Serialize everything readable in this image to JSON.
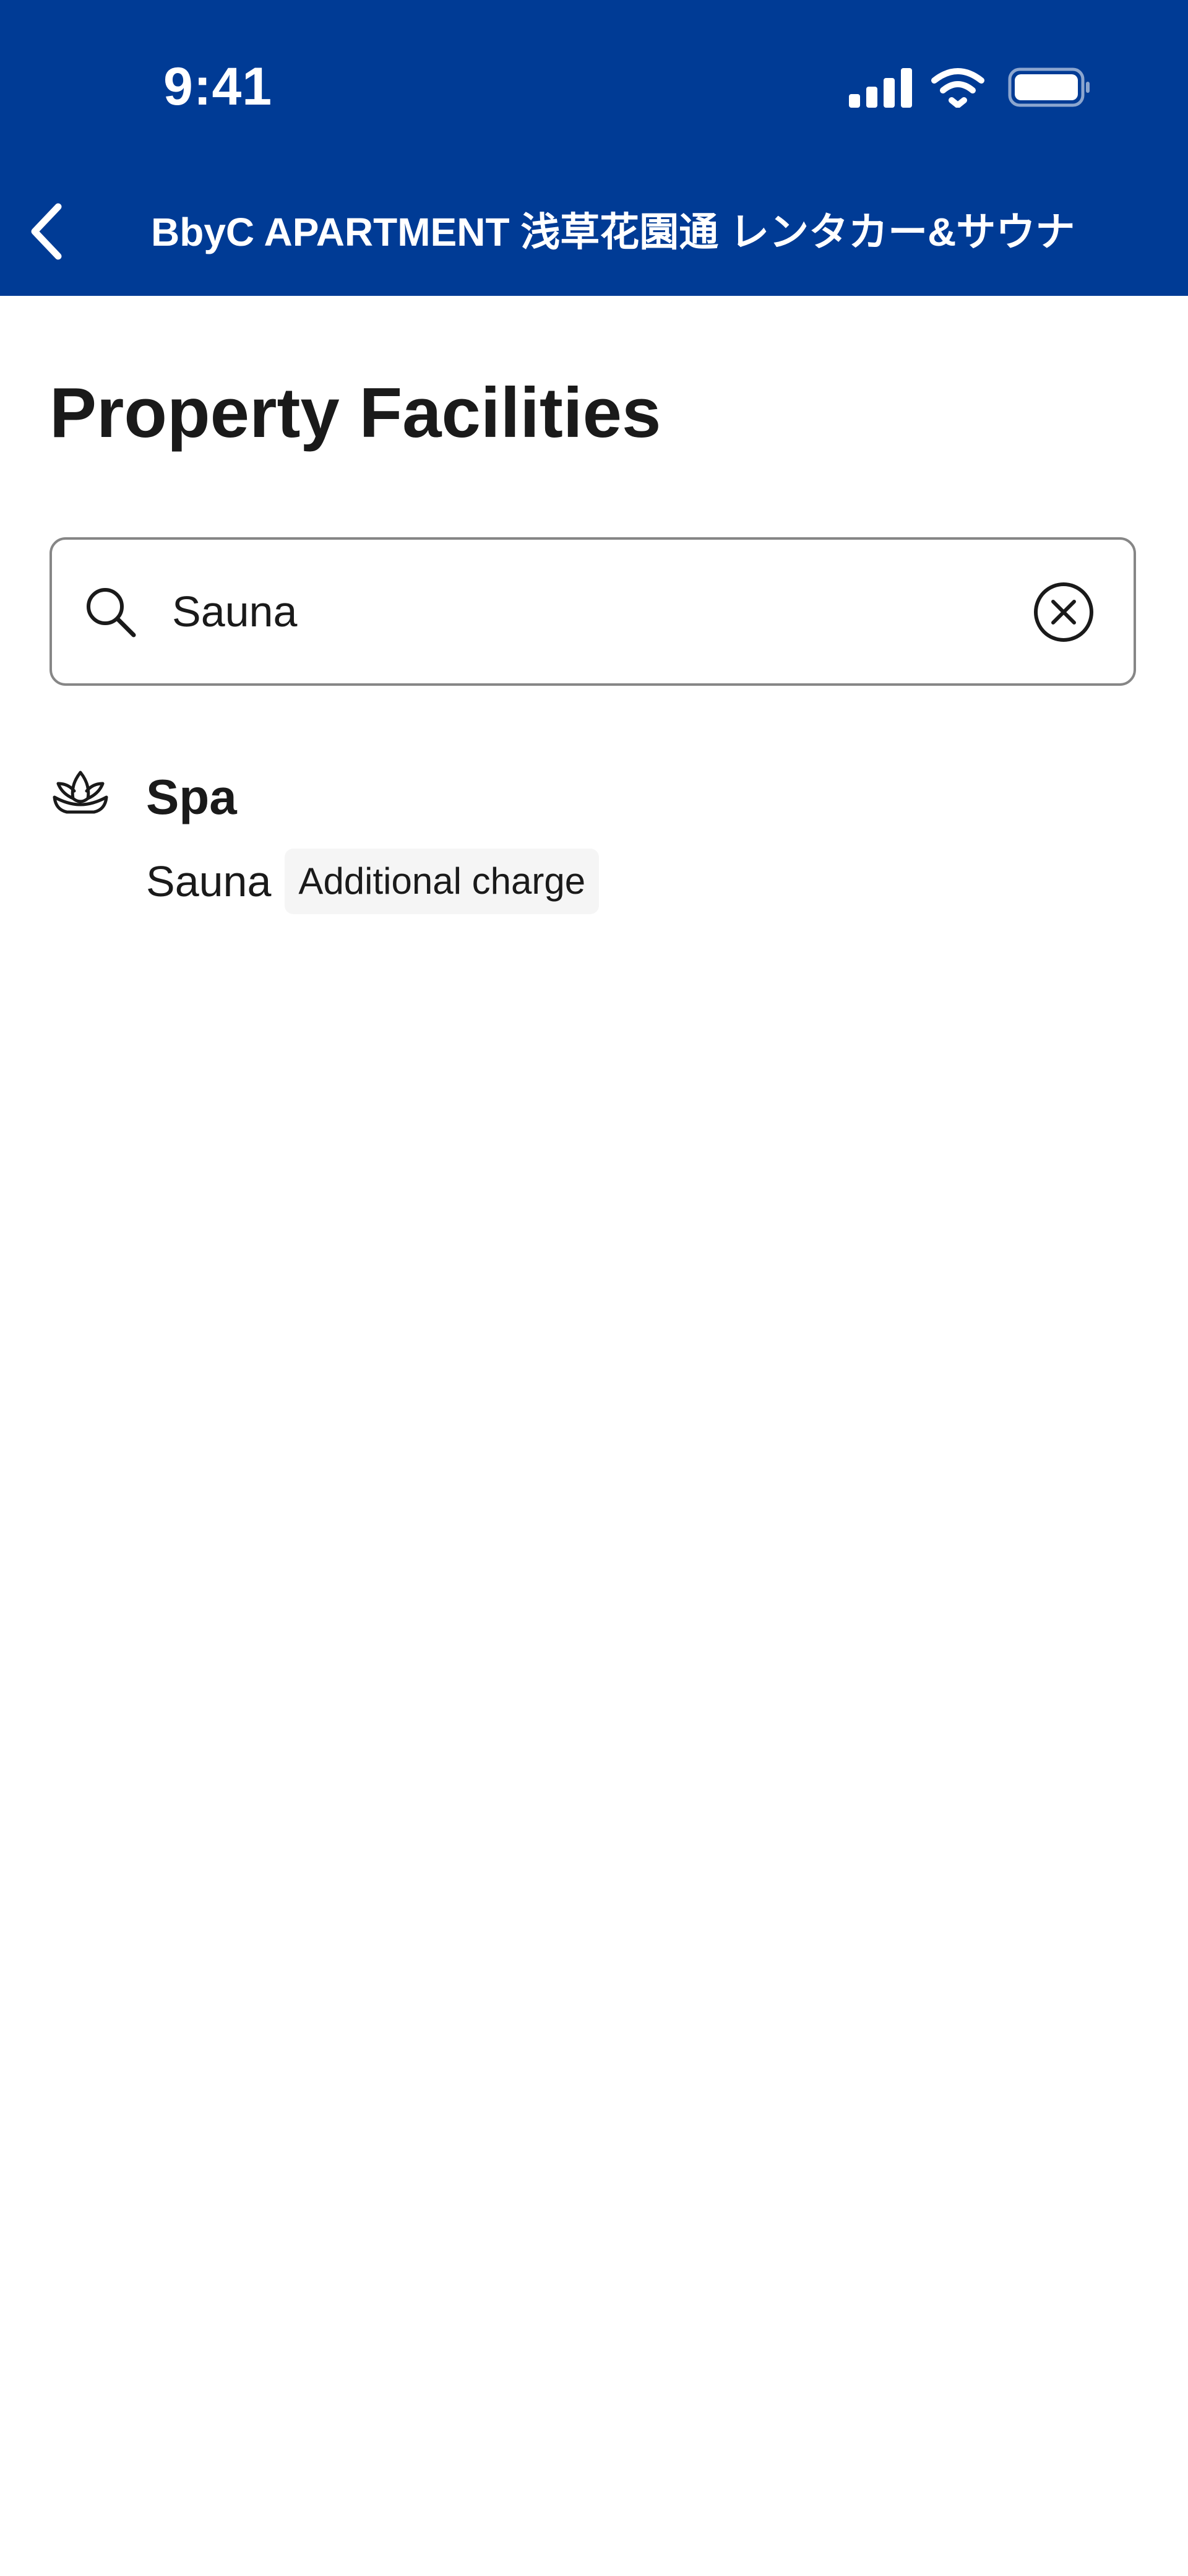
{
  "status_bar": {
    "time": "9:41",
    "icons": [
      "cellular-signal-icon",
      "wifi-icon",
      "battery-icon"
    ]
  },
  "nav": {
    "back_icon": "chevron-left-icon",
    "title": "BbyC APARTMENT 浅草花園通 レンタカー&サウナ"
  },
  "page": {
    "title": "Property Facilities"
  },
  "search": {
    "icon": "search-icon",
    "value": "Sauna",
    "clear_icon": "clear-circle-icon"
  },
  "results": [
    {
      "icon": "spa-lotus-icon",
      "category": "Spa",
      "items": [
        {
          "name": "Sauna",
          "badge": "Additional charge"
        }
      ]
    }
  ],
  "colors": {
    "header_bg": "#003b95",
    "header_text": "#ffffff",
    "text": "#1a1a1a",
    "search_border": "#868686",
    "badge_bg": "#f5f5f5"
  }
}
